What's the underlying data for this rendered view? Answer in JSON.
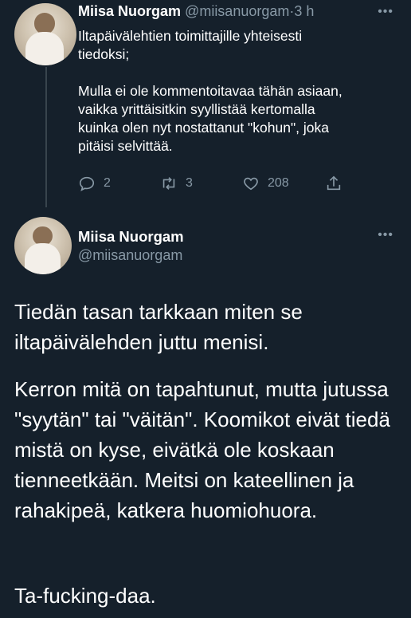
{
  "tweet1": {
    "author_name": "Miisa Nuorgam",
    "handle": "@miisanuorgam",
    "separator": "·",
    "time": "3 h",
    "text": "Iltapäivälehtien toimittajille yhteisesti\ntiedoksi;\n\nMulla ei ole kommentoitavaa tähän asiaan,\nvaikka yrittäisitkin syyllistää kertomalla\nkuinka olen nyt nostattanut \"kohun\", joka\npitäisi selvittää.",
    "more": "•••",
    "replies": "2",
    "retweets": "3",
    "likes": "208"
  },
  "tweet2": {
    "author_name": "Miisa Nuorgam",
    "handle": "@miisanuorgam",
    "more": "•••",
    "paragraphs": [
      "Tiedän tasan tarkkaan miten se iltapäivälehden juttu menisi.",
      "Kerron mitä on tapahtunut, mutta jutussa \"syytän\" tai \"väitän\". Koomikot eivät tiedä mistä on kyse, eivätkä ole koskaan tienneetkään. Meitsi on kateellinen ja rahakipeä, katkera huomiohuora.",
      "Ta-fucking-daa."
    ]
  },
  "colors": {
    "background": "#15202b",
    "text": "#ffffff",
    "muted": "#8899a6",
    "divider": "#38444d"
  },
  "icons": [
    "reply-icon",
    "retweet-icon",
    "like-icon",
    "share-icon",
    "more-icon"
  ]
}
